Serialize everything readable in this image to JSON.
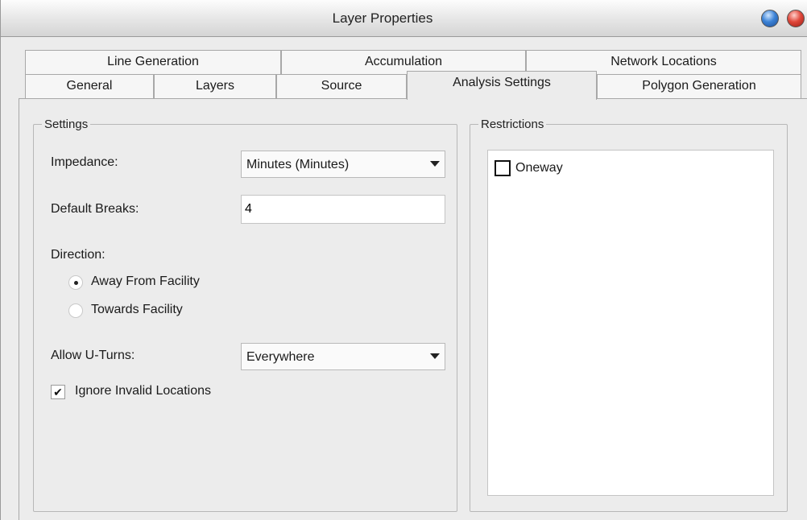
{
  "window": {
    "title": "Layer Properties"
  },
  "tabs": {
    "row1": [
      "Line Generation",
      "Accumulation",
      "Network Locations"
    ],
    "row2": [
      "General",
      "Layers",
      "Source",
      "Analysis Settings",
      "Polygon Generation"
    ],
    "active": "Analysis Settings"
  },
  "settings": {
    "legend": "Settings",
    "impedance_label": "Impedance:",
    "impedance_value": "Minutes (Minutes)",
    "default_breaks_label": "Default Breaks:",
    "default_breaks_value": "4",
    "direction_label": "Direction:",
    "direction_options": [
      {
        "label": "Away From Facility",
        "selected": true
      },
      {
        "label": "Towards Facility",
        "selected": false
      }
    ],
    "uturns_label": "Allow U-Turns:",
    "uturns_value": "Everywhere",
    "ignore_invalid_label": "Ignore Invalid Locations",
    "ignore_invalid_checked": true,
    "check_glyph": "✔"
  },
  "restrictions": {
    "legend": "Restrictions",
    "items": [
      {
        "label": "Oneway",
        "checked": false
      }
    ]
  },
  "colors": {
    "close_button": "#e0473a",
    "zoom_button": "#3b82d6",
    "dialog_background": "#ececec"
  }
}
